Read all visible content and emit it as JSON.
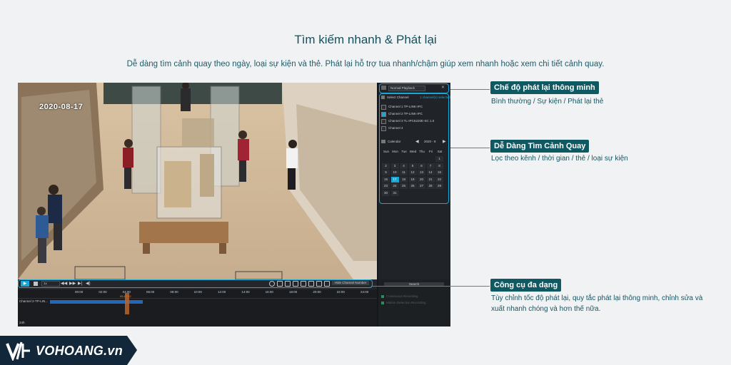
{
  "header": {
    "title": "Tìm kiếm nhanh & Phát lại",
    "subtitle": "Dễ dàng tìm cảnh quay theo ngày, loại sự kiện và thẻ. Phát lại hỗ trợ tua nhanh/chậm giúp xem nhanh hoặc xem chi tiết cảnh quay."
  },
  "video": {
    "date_overlay": "2020-08-17"
  },
  "panel": {
    "mode_label": "Normal Playback",
    "select_channel_label": "Select Channel",
    "channel_count": "1 channel(s) selected",
    "channels": [
      {
        "name": "Channel 1 TP-LINK-IPC",
        "checked": false
      },
      {
        "name": "Channel 2 TP-LINK-IPC",
        "checked": true
      },
      {
        "name": "Channel 3 TL-IPC5220E-SC 1.0",
        "checked": false
      },
      {
        "name": "Channel 4",
        "checked": false
      }
    ],
    "calendar_label": "Calendar",
    "calendar_month": "2020 - 8",
    "weekdays": [
      "Sun",
      "Mon",
      "Tue",
      "Wed",
      "Thu",
      "Fri",
      "Sat"
    ],
    "days": [
      "",
      "",
      "",
      "",
      "",
      "",
      "1",
      "2",
      "3",
      "4",
      "5",
      "6",
      "7",
      "8",
      "9",
      "10",
      "11",
      "12",
      "13",
      "14",
      "15",
      "16",
      "17",
      "18",
      "19",
      "20",
      "21",
      "22",
      "23",
      "24",
      "25",
      "26",
      "27",
      "28",
      "29",
      "30",
      "31"
    ],
    "selected_day": "17",
    "search_label": "Search",
    "legend_continuous": "Continuous Recording",
    "legend_motion": "Motion Detection Recording"
  },
  "controls": {
    "speed": "1x",
    "hide_channel_label": "Hide Channel Number"
  },
  "timeline": {
    "hours": [
      "00:00",
      "02:00",
      "04:00",
      "06:00",
      "08:00",
      "10:00",
      "12:00",
      "14:00",
      "16:00",
      "18:00",
      "20:00",
      "22:00",
      "24:00"
    ],
    "cursor_time": "05:45:52",
    "channel_label": "Channel 2-TP-LIN...",
    "zoom_label": "24h"
  },
  "callouts": [
    {
      "title": "Chế độ phát lại thông minh",
      "desc": [
        "Bình thường / Sự kiện / Phát lại thẻ"
      ]
    },
    {
      "title": "Dễ Dàng Tìm Cảnh Quay",
      "desc": [
        "Lọc theo kênh / thời gian / thẻ / loại sự kiện"
      ]
    },
    {
      "title": "Công cụ đa dạng",
      "desc": [
        "Tùy chỉnh tốc độ phát lại, quy tắc phát lại thông minh, chỉnh sửa và",
        "xuất nhanh chóng và hơn thế nữa."
      ]
    }
  ],
  "brand": {
    "logo_text": "VOHOANG.vn",
    "accent_color": "#1aa7d6",
    "badge_color": "#0f5963"
  }
}
